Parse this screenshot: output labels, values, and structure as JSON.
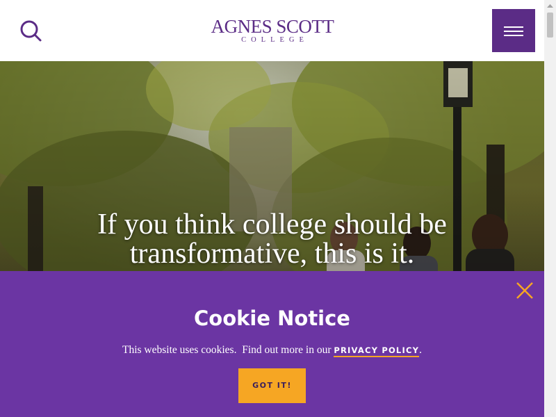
{
  "header": {
    "logo_main": "AGNES SCOTT",
    "logo_sub": "COLLEGE",
    "search_icon": "search-icon",
    "menu_icon": "hamburger-menu-icon",
    "brand_color": "#5b2c86"
  },
  "hero": {
    "headline": "If you think college should be transformative, this is it."
  },
  "cookie_notice": {
    "title": "Cookie Notice",
    "text_before": "This website uses cookies.  Find out more in our ",
    "link_label": "PRIVACY POLICY",
    "text_after": ".",
    "button_label": "GOT IT!",
    "close_icon": "close-icon",
    "background_color": "#6b35a3",
    "accent_color": "#f6a623"
  }
}
